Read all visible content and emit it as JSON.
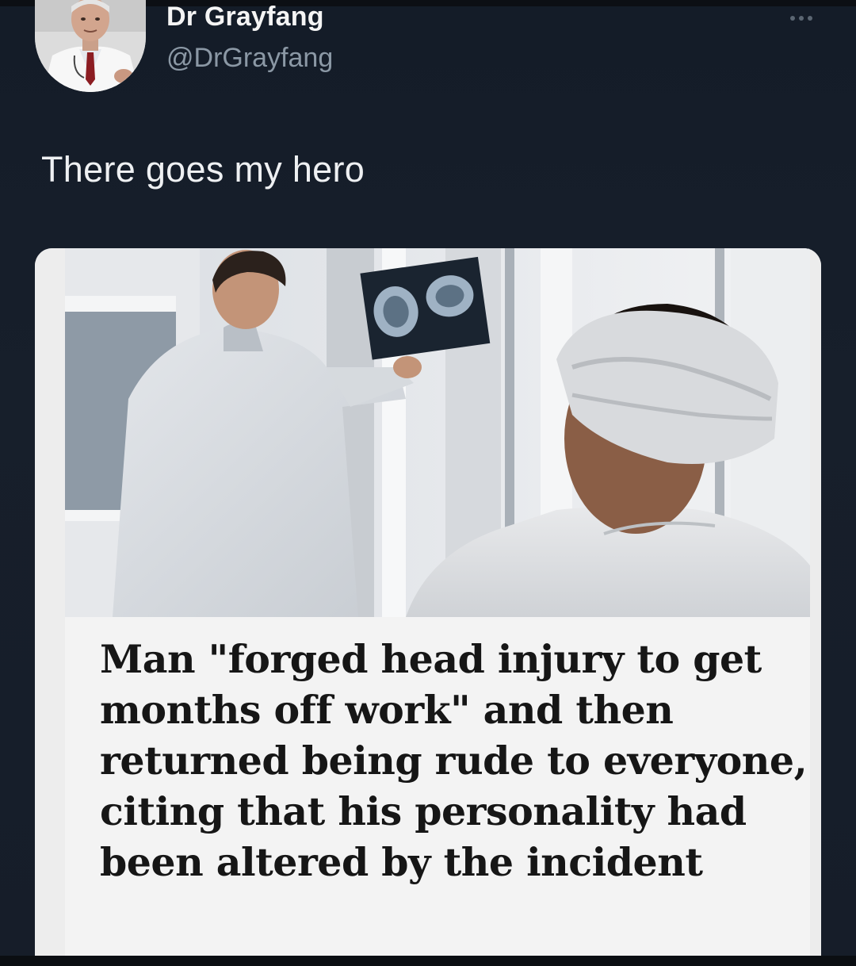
{
  "tweet": {
    "display_name": "Dr Grayfang",
    "handle": "@DrGrayfang",
    "text": "There goes my hero",
    "more_icon": "more-horizontal-icon"
  },
  "card": {
    "headline": "Man \"forged head injury to get months off work\" and then returned being rude to everyone, citing that his personality had been altered by the incident"
  },
  "colors": {
    "background": "#15202b",
    "name": "#f4f4f4",
    "handle": "#8b98a5",
    "card_background": "#f3f3f3",
    "headline": "#161616"
  }
}
